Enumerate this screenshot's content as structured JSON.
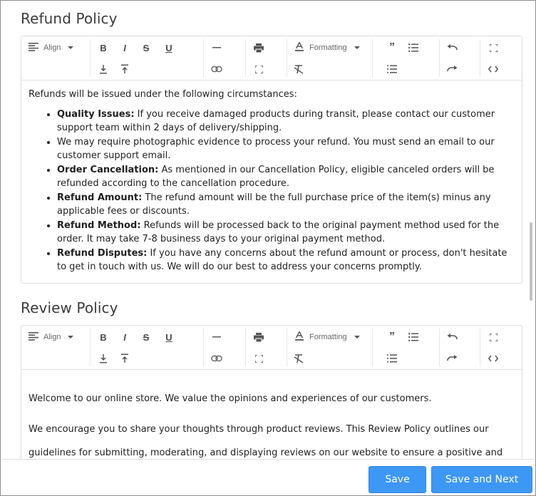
{
  "refund": {
    "title": "Refund Policy",
    "intro": "Refunds will be issued under the following circumstances:",
    "items": [
      {
        "label": "Quality Issues:",
        "text": " If you receive damaged products during transit, please contact our customer support team within 2 days of delivery/shipping."
      },
      {
        "label": "",
        "text": "We may require photographic evidence to process your refund. You must send an email to our customer support email."
      },
      {
        "label": "Order Cancellation:",
        "text": " As mentioned in our Cancellation Policy, eligible canceled orders will be refunded according to the cancellation procedure."
      },
      {
        "label": "Refund Amount:",
        "text": " The refund amount will be the full purchase price of the item(s) minus any applicable fees or discounts."
      },
      {
        "label": "Refund Method:",
        "text": " Refunds will be processed back to the original payment method used for the order. It may take 7-8 business days to your original payment method."
      },
      {
        "label": "Refund Disputes:",
        "text": " If you have any concerns about the refund amount or process, don't hesitate to get in touch with us. We will do our best to address your concerns promptly."
      }
    ]
  },
  "review": {
    "title": "Review Policy",
    "para1": "Welcome to our online store. We value the opinions and experiences of our customers.",
    "para2": "We encourage you to share your thoughts through product reviews. This Review Policy outlines our guidelines for submitting, moderating, and displaying reviews on our website to ensure a positive and informative shopping"
  },
  "toolbar": {
    "align_label": "Align",
    "formatting_label": "Formatting",
    "icons": [
      "align-left-icon",
      "bold-icon",
      "italic-icon",
      "strikethrough-icon",
      "underline-icon",
      "subscript-icon",
      "superscript-icon",
      "horizontal-rule-icon",
      "link-icon",
      "print-icon",
      "fullscreen-icon",
      "font-color-icon",
      "clear-format-icon",
      "blockquote-icon",
      "bullet-list-icon",
      "numbered-list-icon",
      "undo-icon",
      "redo-icon",
      "expand-icon",
      "code-view-icon"
    ]
  },
  "footer": {
    "save_label": "Save",
    "save_next_label": "Save and Next"
  },
  "colors": {
    "primary": "#3d97f5",
    "border": "#dcdcdc",
    "text": "#1f1f1f"
  }
}
